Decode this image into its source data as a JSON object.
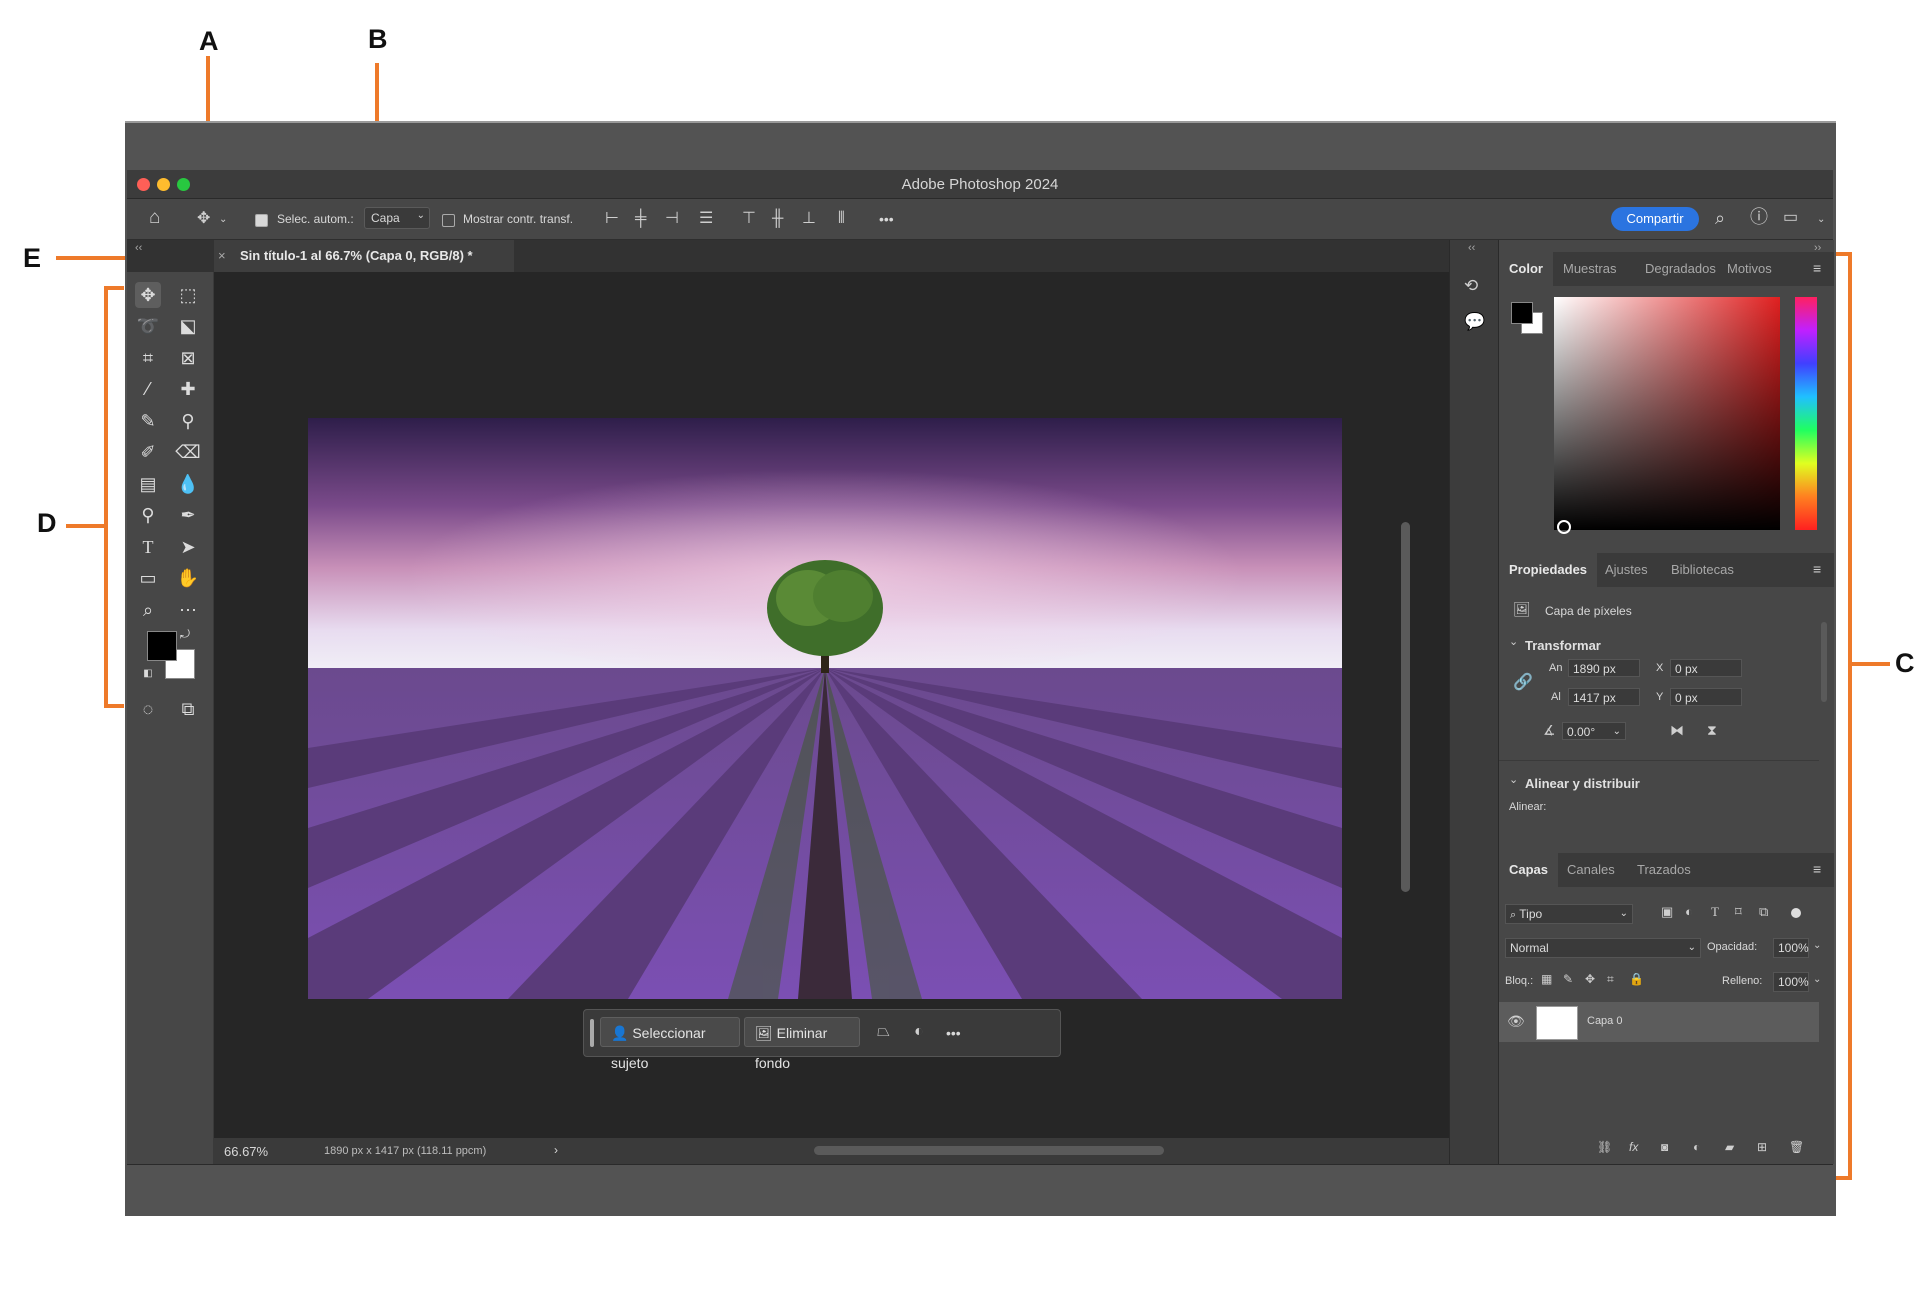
{
  "annotations": {
    "a": "A",
    "b": "B",
    "c": "C",
    "d": "D",
    "e": "E"
  },
  "app": {
    "title": "Adobe Photoshop 2024"
  },
  "options_bar": {
    "auto_select_label": "Selec. autom.:",
    "auto_select_value": "Capa",
    "show_transform_label": "Mostrar contr. transf.",
    "more": "•••",
    "share_label": "Compartir"
  },
  "document": {
    "tab_label": "Sin título-1 al 66.7% (Capa 0, RGB/8) *",
    "close": "×"
  },
  "contextual_bar": {
    "select_subject": "Seleccionar sujeto",
    "remove_background": "Eliminar fondo",
    "more": "•••"
  },
  "status": {
    "zoom": "66.67%",
    "info": "1890 px x 1417 px (118.11 ppcm)",
    "arrow": "›"
  },
  "color_panel": {
    "tabs": [
      "Color",
      "Muestras",
      "Degradados",
      "Motivos"
    ],
    "foreground": "#000000",
    "background": "#ffffff"
  },
  "properties_panel": {
    "tabs": [
      "Propiedades",
      "Ajustes",
      "Bibliotecas"
    ],
    "layer_kind": "Capa de píxeles",
    "transform_title": "Transformar",
    "width_label": "An",
    "width_value": "1890 px",
    "height_label": "Al",
    "height_value": "1417 px",
    "x_label": "X",
    "x_value": "0 px",
    "y_label": "Y",
    "y_value": "0 px",
    "angle_value": "0.00°",
    "align_title": "Alinear y distribuir",
    "align_label": "Alinear:"
  },
  "layers_panel": {
    "tabs": [
      "Capas",
      "Canales",
      "Trazados"
    ],
    "filter": "Tipo",
    "blend_mode": "Normal",
    "opacity_label": "Opacidad:",
    "opacity_value": "100%",
    "lock_label": "Bloq.:",
    "fill_label": "Relleno:",
    "fill_value": "100%",
    "layers": [
      {
        "name": "Capa 0",
        "visible": true
      }
    ]
  },
  "colors": {
    "accent": "#2b74e0",
    "annotation": "#ee7a2a"
  }
}
